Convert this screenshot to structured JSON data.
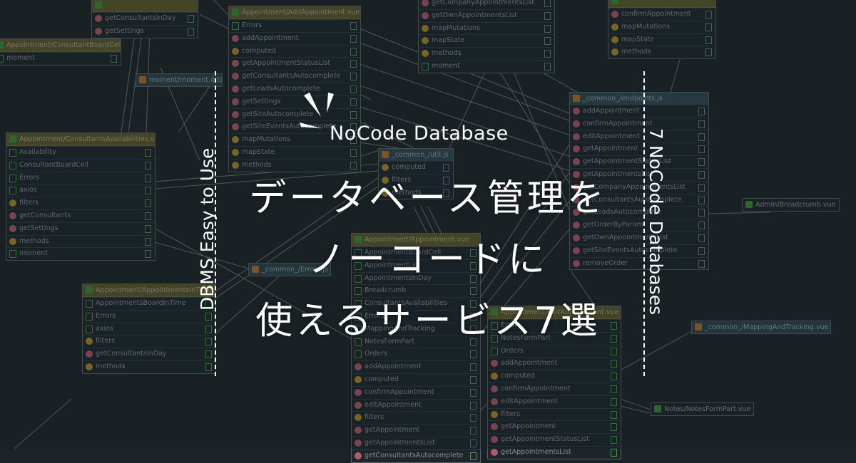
{
  "banner": {
    "subtitle": "NoCode Database",
    "title_lines": [
      "データベース管理を",
      "ノーコードに",
      "使えるサービス7選"
    ],
    "side_left": "DBMS Easy to Use",
    "side_right": "7 NoCode Databases",
    "text_color": "#ffffff",
    "background_color": "#1c2429"
  },
  "diagram": {
    "nodes": [
      {
        "id": "n-top-left",
        "title": "",
        "type": "vue",
        "rows": [
          {
            "label": "getConsultantsInDay",
            "icon": "function"
          },
          {
            "label": "getSettings",
            "icon": "function"
          }
        ]
      },
      {
        "id": "n-consultant-board-cell",
        "title": "Appointment/ConsultantBoardCell.vue",
        "type": "vue",
        "rows": [
          {
            "label": "moment",
            "icon": "import"
          }
        ]
      },
      {
        "id": "n-moment",
        "title": "moment/moment.d.ts",
        "type": "single-js",
        "rows": []
      },
      {
        "id": "n-consultants-availabilities",
        "title": "Appointment/ConsultantsAvailabilities.vue",
        "type": "vue",
        "rows": [
          {
            "label": "Availability",
            "icon": "import"
          },
          {
            "label": "ConsultantBoardCell",
            "icon": "import"
          },
          {
            "label": "Errors",
            "icon": "import"
          },
          {
            "label": "axios",
            "icon": "import"
          },
          {
            "label": "filters",
            "icon": "vue"
          },
          {
            "label": "getConsultants",
            "icon": "function"
          },
          {
            "label": "getSettings",
            "icon": "function"
          },
          {
            "label": "methods",
            "icon": "vue"
          },
          {
            "label": "moment",
            "icon": "import"
          }
        ]
      },
      {
        "id": "n-appointments-in-time",
        "title": "Appointment/AppointmentsInTime.vue",
        "type": "vue",
        "rows": [
          {
            "label": "AppointmentsBoardInTime",
            "icon": "import"
          },
          {
            "label": "Errors",
            "icon": "import"
          },
          {
            "label": "axios",
            "icon": "import"
          },
          {
            "label": "filters",
            "icon": "vue"
          },
          {
            "label": "getConsultantsInDay",
            "icon": "function"
          },
          {
            "label": "methods",
            "icon": "vue"
          }
        ]
      },
      {
        "id": "n-add-appointment",
        "title": "Appointment/AddAppointment.vue",
        "type": "vue",
        "rows": [
          {
            "label": "Errors",
            "icon": "import"
          },
          {
            "label": "addAppointment",
            "icon": "function"
          },
          {
            "label": "computed",
            "icon": "vue"
          },
          {
            "label": "getAppointmentStatusList",
            "icon": "function"
          },
          {
            "label": "getConsultantsAutocomplete",
            "icon": "function"
          },
          {
            "label": "getLeadsAutocomplete",
            "icon": "function"
          },
          {
            "label": "getSettings",
            "icon": "function"
          },
          {
            "label": "getSiteAutocomplete",
            "icon": "function"
          },
          {
            "label": "getSiteEventsAutocomplete",
            "icon": "function"
          },
          {
            "label": "mapMutations",
            "icon": "vue"
          },
          {
            "label": "mapState",
            "icon": "vue"
          },
          {
            "label": "methods",
            "icon": "vue"
          }
        ]
      },
      {
        "id": "n-top-center",
        "title": "",
        "type": "vue",
        "rows": [
          {
            "label": "getCompanyAppointmentsList",
            "icon": "function"
          },
          {
            "label": "getOwnAppointmentsList",
            "icon": "function"
          },
          {
            "label": "mapMutations",
            "icon": "vue"
          },
          {
            "label": "mapState",
            "icon": "vue"
          },
          {
            "label": "methods",
            "icon": "vue"
          },
          {
            "label": "moment",
            "icon": "import"
          }
        ]
      },
      {
        "id": "n-top-right",
        "title": "",
        "type": "vue",
        "rows": [
          {
            "label": "confirmAppointment",
            "icon": "function"
          },
          {
            "label": "mapMutations",
            "icon": "vue"
          },
          {
            "label": "mapState",
            "icon": "vue"
          },
          {
            "label": "methods",
            "icon": "vue"
          }
        ]
      },
      {
        "id": "n-util",
        "title": "_common_/util.js",
        "type": "js",
        "rows": [
          {
            "label": "computed",
            "icon": "vue",
            "export": true
          },
          {
            "label": "filters",
            "icon": "vue",
            "export": true
          },
          {
            "label": "methods",
            "icon": "vue",
            "export": true
          }
        ]
      },
      {
        "id": "n-endpoints",
        "title": "_common_/endpoints.js",
        "type": "js",
        "rows": [
          {
            "label": "addAppointment",
            "icon": "function",
            "export": true
          },
          {
            "label": "confirmAppointment",
            "icon": "function",
            "export": true
          },
          {
            "label": "editAppointment",
            "icon": "function",
            "export": true
          },
          {
            "label": "getAppointment",
            "icon": "function",
            "export": true
          },
          {
            "label": "getAppointmentStatusList",
            "icon": "function",
            "export": true
          },
          {
            "label": "getAppointmentsList",
            "icon": "function",
            "export": true
          },
          {
            "label": "getCompanyAppointmentsList",
            "icon": "function",
            "export": true
          },
          {
            "label": "getConsultantsAutocomplete",
            "icon": "function",
            "export": true
          },
          {
            "label": "getLeadsAutocomplete",
            "icon": "function",
            "export": true
          },
          {
            "label": "getOrderByParam",
            "icon": "function",
            "export": true
          },
          {
            "label": "getOwnAppointmentsList",
            "icon": "function",
            "export": true
          },
          {
            "label": "getSiteEventsAutocomplete",
            "icon": "function",
            "export": true
          },
          {
            "label": "removeOrder",
            "icon": "function",
            "export": true
          }
        ]
      },
      {
        "id": "n-errors",
        "title": "_common_/Errors.js",
        "type": "single-js",
        "rows": []
      },
      {
        "id": "n-appointment",
        "title": "Appointment/Appointment.vue",
        "type": "vue",
        "rows": [
          {
            "label": "AppointmentBoardCell",
            "icon": "import"
          },
          {
            "label": "AppointmentList",
            "icon": "import"
          },
          {
            "label": "AppointmentsInDay",
            "icon": "import"
          },
          {
            "label": "Breadcrumb",
            "icon": "import"
          },
          {
            "label": "ConsultantsAvailabilities",
            "icon": "import"
          },
          {
            "label": "Errors",
            "icon": "import"
          },
          {
            "label": "MappingAndTracking",
            "icon": "import"
          },
          {
            "label": "NotesFormPart",
            "icon": "import"
          },
          {
            "label": "Orders",
            "icon": "import"
          },
          {
            "label": "addAppointment",
            "icon": "function"
          },
          {
            "label": "computed",
            "icon": "vue"
          },
          {
            "label": "confirmAppointment",
            "icon": "function"
          },
          {
            "label": "editAppointment",
            "icon": "function"
          },
          {
            "label": "filters",
            "icon": "vue"
          },
          {
            "label": "getAppointment",
            "icon": "function"
          },
          {
            "label": "getAppointmentsList",
            "icon": "function"
          },
          {
            "label": "getConsultantsAutocomplete",
            "icon": "function"
          }
        ]
      },
      {
        "id": "n-edit-appointment",
        "title": "Appointment/EditAppointment.vue",
        "type": "vue",
        "rows": [
          {
            "label": "Errors",
            "icon": "import"
          },
          {
            "label": "NotesFormPart",
            "icon": "import"
          },
          {
            "label": "Orders",
            "icon": "import"
          },
          {
            "label": "addAppointment",
            "icon": "function"
          },
          {
            "label": "computed",
            "icon": "vue"
          },
          {
            "label": "confirmAppointment",
            "icon": "function"
          },
          {
            "label": "editAppointment",
            "icon": "function"
          },
          {
            "label": "filters",
            "icon": "vue"
          },
          {
            "label": "getAppointment",
            "icon": "function"
          },
          {
            "label": "getAppointmentStatusList",
            "icon": "function"
          },
          {
            "label": "getAppointmentsList",
            "icon": "function"
          }
        ]
      },
      {
        "id": "n-breadcrumb",
        "title": "Admin/Breadcrumb.vue",
        "type": "single-vue",
        "rows": []
      },
      {
        "id": "n-mapping",
        "title": "_common_/MappingAndTracking.vue",
        "type": "single-js",
        "rows": []
      },
      {
        "id": "n-notes",
        "title": "Notes/NotesFormPart.vue",
        "type": "single-vue",
        "rows": []
      }
    ]
  }
}
